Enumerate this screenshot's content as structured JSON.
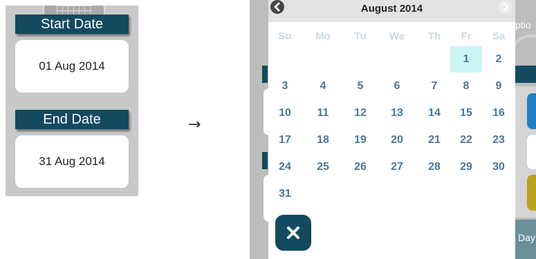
{
  "left_panel": {
    "start_label": "Start Date",
    "start_value": "01 Aug 2014",
    "end_label": "End Date",
    "end_value": "31 Aug 2014"
  },
  "transition_arrow": "→",
  "background_app": {
    "option_text": "ptio",
    "day_text": "Day"
  },
  "calendar": {
    "title": "August 2014",
    "prev_icon": "chevron-left-icon",
    "next_icon": "chevron-right-icon",
    "weekdays": [
      "Su",
      "Mo",
      "Tu",
      "We",
      "Th",
      "Fr",
      "Sa"
    ],
    "weeks": [
      [
        "",
        "",
        "",
        "",
        "",
        "1",
        "2"
      ],
      [
        "3",
        "4",
        "5",
        "6",
        "7",
        "8",
        "9"
      ],
      [
        "10",
        "11",
        "12",
        "13",
        "14",
        "15",
        "16"
      ],
      [
        "17",
        "18",
        "19",
        "20",
        "21",
        "22",
        "23"
      ],
      [
        "24",
        "25",
        "26",
        "27",
        "28",
        "29",
        "30"
      ],
      [
        "31",
        "",
        "",
        "",
        "",
        "",
        ""
      ]
    ],
    "selected_day": "1",
    "close_icon": "close-icon"
  },
  "colors": {
    "label_bg": "#134a60",
    "day_text": "#4a7896",
    "weekday_text": "#ccd8df",
    "selected_bg": "#cbf5f7"
  }
}
